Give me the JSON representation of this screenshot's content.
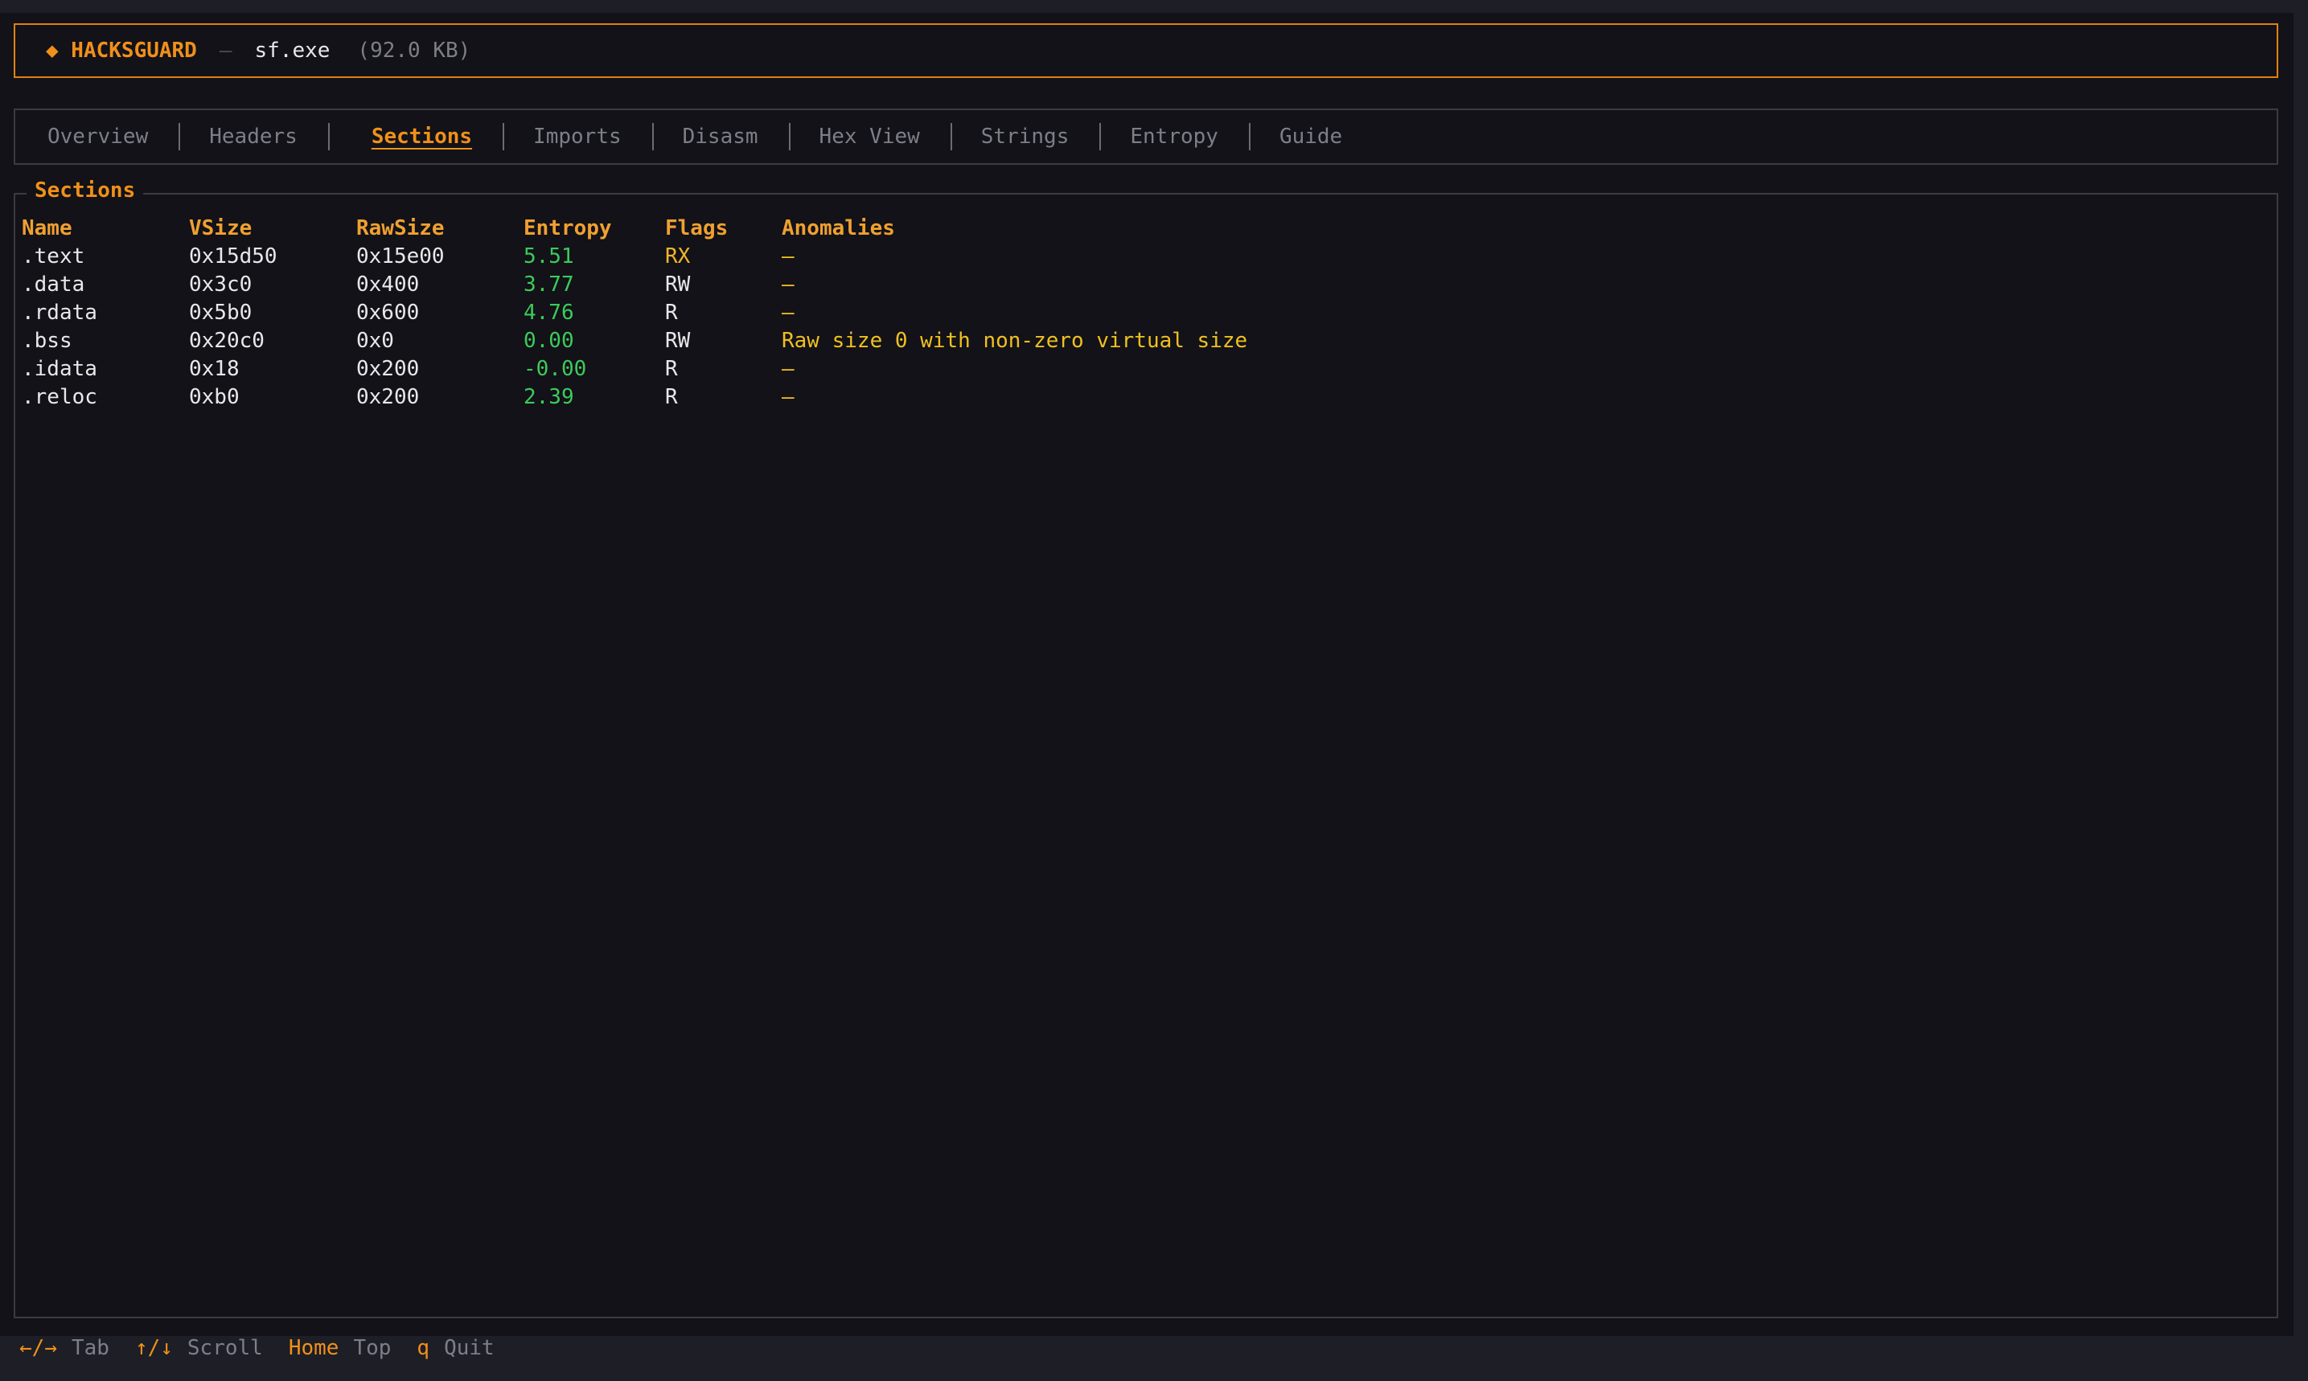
{
  "header": {
    "brand": "◆ HACKSGUARD",
    "separator": "—",
    "filename": "sf.exe",
    "filesize": "(92.0 KB)"
  },
  "tabs": [
    {
      "label": "Overview",
      "active": false
    },
    {
      "label": "Headers",
      "active": false
    },
    {
      "label": "Sections",
      "active": true
    },
    {
      "label": "Imports",
      "active": false
    },
    {
      "label": "Disasm",
      "active": false
    },
    {
      "label": "Hex View",
      "active": false
    },
    {
      "label": "Strings",
      "active": false
    },
    {
      "label": "Entropy",
      "active": false
    },
    {
      "label": "Guide",
      "active": false
    }
  ],
  "panel": {
    "title": "Sections",
    "columns": [
      "Name",
      "VSize",
      "RawSize",
      "Entropy",
      "Flags",
      "Anomalies"
    ],
    "rows": [
      {
        "name": ".text",
        "vsize": "0x15d50",
        "rawsize": "0x15e00",
        "entropy": "5.51",
        "flags": "RX",
        "anomalies": "—"
      },
      {
        "name": ".data",
        "vsize": "0x3c0",
        "rawsize": "0x400",
        "entropy": "3.77",
        "flags": "RW",
        "anomalies": "—"
      },
      {
        "name": ".rdata",
        "vsize": "0x5b0",
        "rawsize": "0x600",
        "entropy": "4.76",
        "flags": "R",
        "anomalies": "—"
      },
      {
        "name": ".bss",
        "vsize": "0x20c0",
        "rawsize": "0x0",
        "entropy": "0.00",
        "flags": "RW",
        "anomalies": "Raw size 0 with non-zero virtual size"
      },
      {
        "name": ".idata",
        "vsize": "0x18",
        "rawsize": "0x200",
        "entropy": "-0.00",
        "flags": "R",
        "anomalies": "—"
      },
      {
        "name": ".reloc",
        "vsize": "0xb0",
        "rawsize": "0x200",
        "entropy": "2.39",
        "flags": "R",
        "anomalies": "—"
      }
    ]
  },
  "footer": {
    "hints": [
      {
        "key": "←/→",
        "action": "Tab"
      },
      {
        "key": "↑/↓",
        "action": "Scroll"
      },
      {
        "key": "Home",
        "action": "Top"
      },
      {
        "key": "q",
        "action": "Quit"
      }
    ]
  },
  "colors": {
    "accent": "#f0901a",
    "entropy": "#3ccb5a",
    "anomaly": "#f0c020",
    "background": "#121218"
  }
}
